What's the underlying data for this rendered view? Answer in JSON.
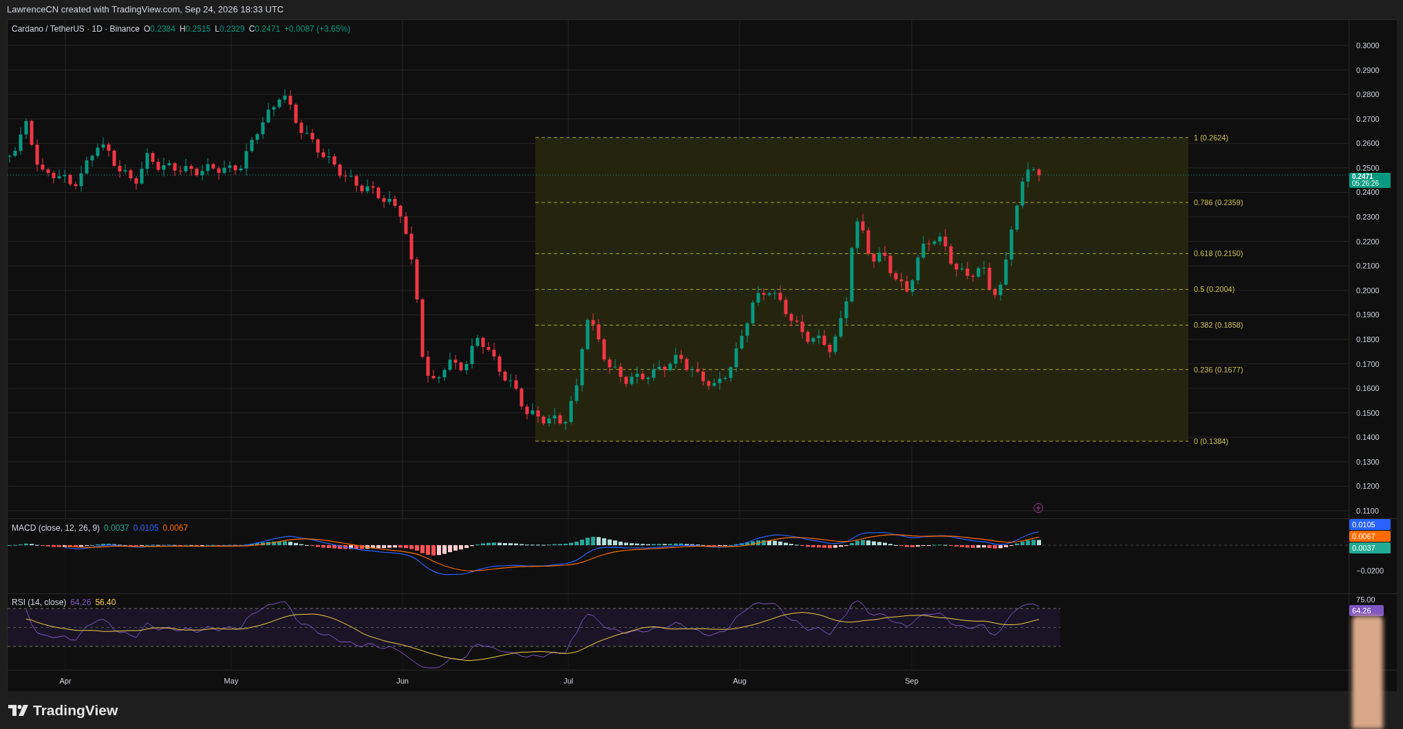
{
  "header": {
    "credit": "LawrenceCN created with TradingView.com, Sep 24, 2026 18:33 UTC"
  },
  "legend": {
    "symbol": "Cardano / TetherUS · 1D · Binance",
    "ohlc": [
      {
        "key": "O",
        "value": "0.2384"
      },
      {
        "key": "H",
        "value": "0.2515"
      },
      {
        "key": "L",
        "value": "0.2329"
      },
      {
        "key": "C",
        "value": "0.2471"
      }
    ],
    "change": "+0.0087 (+3.65%)"
  },
  "price_axis": [
    "0.3000",
    "0.2900",
    "0.2800",
    "0.2700",
    "0.2600",
    "0.2500",
    "0.2400",
    "0.2300",
    "0.2200",
    "0.2100",
    "0.2000",
    "0.1900",
    "0.1800",
    "0.1700",
    "0.1600",
    "0.1500",
    "0.1400",
    "0.1300",
    "0.1200",
    "0.1100"
  ],
  "price_tag": {
    "price": "0.2471",
    "countdown": "05:26:26"
  },
  "fibonacci": {
    "levels": [
      "1 (0.2624)",
      "0.786 (0.2359)",
      "0.618 (0.2150)",
      "0.5 (0.2004)",
      "0.382 (0.1858)",
      "0.236 (0.1677)",
      "0 (0.1384)"
    ]
  },
  "macd": {
    "title": "MACD (close, 12, 26, 9)",
    "values": [
      {
        "text": "0.0037",
        "color": "#22ab94"
      },
      {
        "text": "0.0105",
        "color": "#2962ff"
      },
      {
        "text": "0.0067",
        "color": "#ff6d00"
      }
    ],
    "tags": [
      {
        "text": "0.0105",
        "color": "#2962ff"
      },
      {
        "text": "0.0067",
        "color": "#ff6d00"
      },
      {
        "text": "0.0037",
        "color": "#22ab94"
      }
    ],
    "axis": [
      "−0.0200"
    ]
  },
  "rsi": {
    "title": "RSI (14, close)",
    "values": [
      {
        "text": "64.26",
        "color": "#7e57c2"
      },
      {
        "text": "56.40",
        "color": "#f7d046"
      }
    ],
    "axis": [
      "75.00"
    ],
    "tag": {
      "text": "64.26",
      "color": "#7e57c2"
    }
  },
  "time_axis": [
    "Apr",
    "May",
    "Jun",
    "Jul",
    "Aug",
    "Sep"
  ],
  "footer": {
    "brand": "TradingView"
  }
}
